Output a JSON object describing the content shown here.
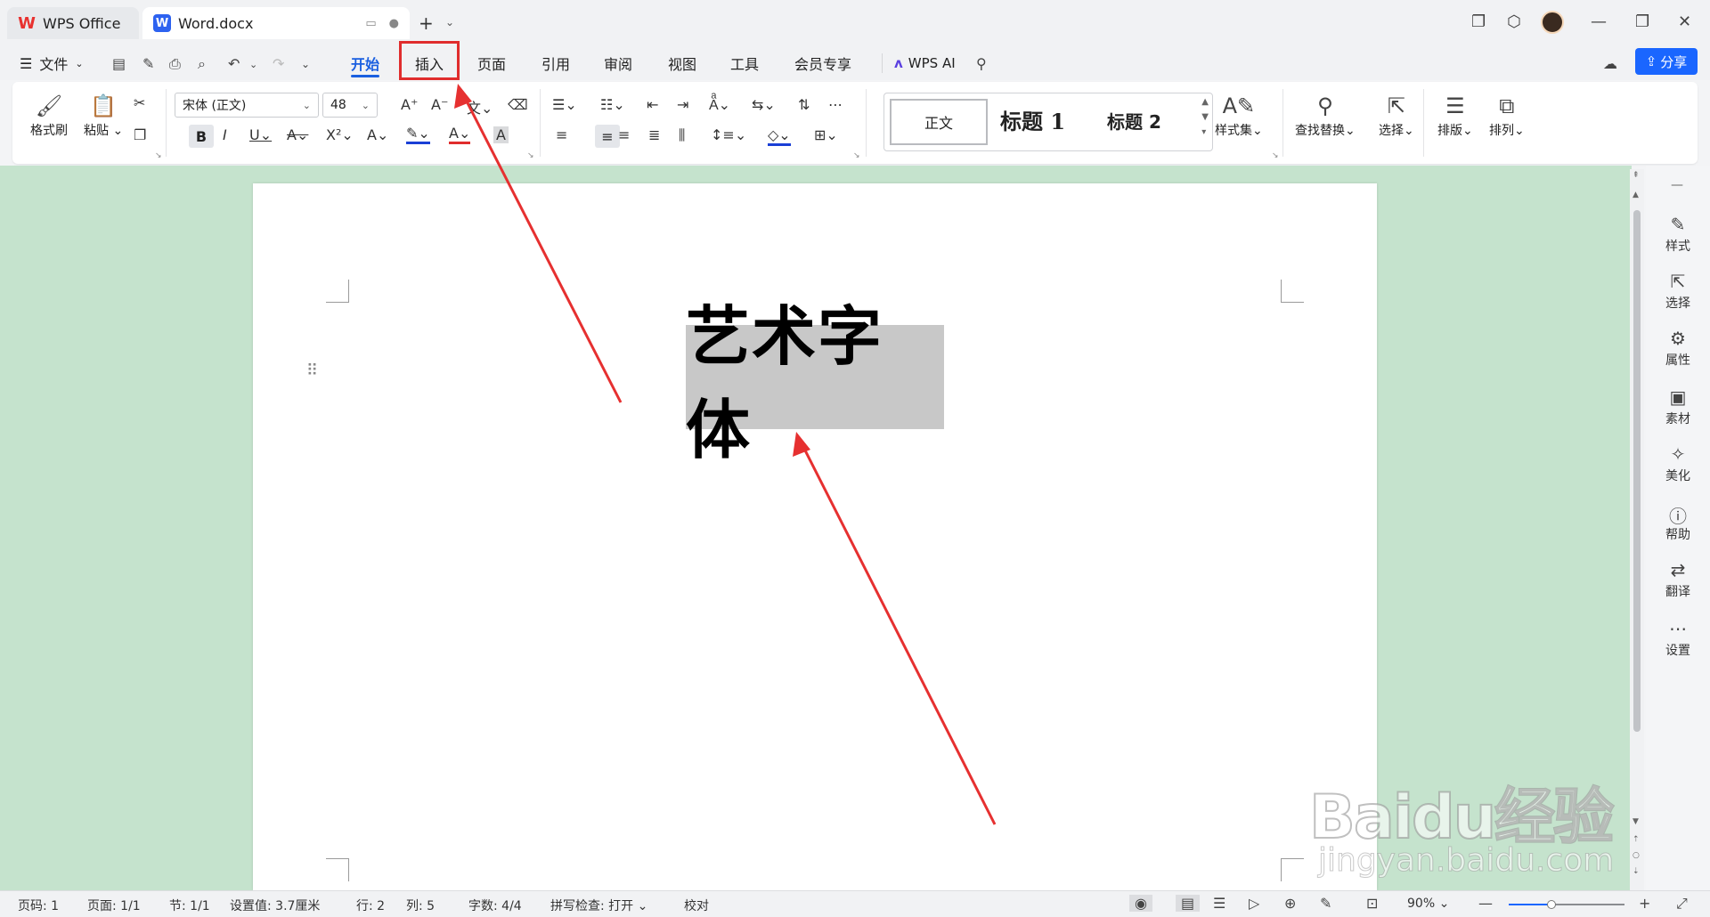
{
  "tabs": [
    {
      "label": "WPS Office"
    },
    {
      "label": "Word.docx"
    }
  ],
  "menu": {
    "file_label": "文件",
    "items": [
      "开始",
      "插入",
      "页面",
      "引用",
      "审阅",
      "视图",
      "工具",
      "会员专享"
    ],
    "active": "开始",
    "ai_label": "WPS AI",
    "share_label": "分享"
  },
  "ribbon": {
    "format_painter": "格式刷",
    "paste": "粘贴",
    "font_name": "宋体 (正文)",
    "font_size": "48",
    "styles": {
      "normal": "正文",
      "h1": "标题 1",
      "h2": "标题 2"
    },
    "style_set": "样式集",
    "find_replace": "查找替换",
    "select": "选择",
    "typeset": "排版",
    "arrange": "排列",
    "font_color": "#e02d2d",
    "highlight_color": "#1a3fd6"
  },
  "document": {
    "art_text": "艺术字体"
  },
  "sidepanel": [
    "样式",
    "选择",
    "属性",
    "素材",
    "美化",
    "帮助",
    "翻译",
    "设置"
  ],
  "status": {
    "page_num": "页码: 1",
    "pages": "页面: 1/1",
    "section": "节: 1/1",
    "position": "设置值: 3.7厘米",
    "line": "行: 2",
    "col": "列: 5",
    "words": "字数: 4/4",
    "spell": "拼写检查: 打开",
    "proof": "校对",
    "zoom": "90%",
    "zoom_fraction": 0.37
  },
  "watermark": {
    "main": "Baidu经验",
    "sub": "jingyan.baidu.com"
  },
  "colors": {
    "accent": "#1a5fe0",
    "workspace": "#c5e3cd",
    "annotation": "#e63030"
  }
}
